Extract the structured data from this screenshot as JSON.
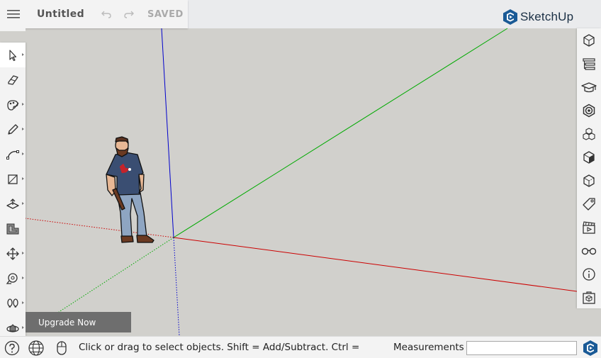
{
  "app": {
    "document_title": "Untitled",
    "save_status": "SAVED",
    "brand_name": "SketchUp"
  },
  "left_toolbar": {
    "tools": [
      {
        "name": "select-tool",
        "icon": "cursor-arrow-icon",
        "active": true
      },
      {
        "name": "eraser-tool",
        "icon": "eraser-icon"
      },
      {
        "name": "paint-bucket-tool",
        "icon": "paint-icon"
      },
      {
        "name": "pencil-tool",
        "icon": "pencil-icon"
      },
      {
        "name": "arc-tool",
        "icon": "arc-icon"
      },
      {
        "name": "rectangle-tool",
        "icon": "rectangle-icon"
      },
      {
        "name": "push-pull-tool",
        "icon": "push-pull-icon"
      },
      {
        "name": "offset-tool",
        "icon": "offset-icon"
      },
      {
        "name": "move-tool",
        "icon": "move-icon"
      },
      {
        "name": "tape-measure-tool",
        "icon": "tape-measure-icon"
      },
      {
        "name": "walk-tool",
        "icon": "footprints-icon"
      },
      {
        "name": "orbit-tool",
        "icon": "orbit-icon"
      }
    ]
  },
  "right_toolbar": {
    "panels": [
      {
        "name": "entity-info-panel",
        "icon": "cube-info-icon"
      },
      {
        "name": "outliner-panel",
        "icon": "outliner-icon"
      },
      {
        "name": "instructor-panel",
        "icon": "graduation-cap-icon"
      },
      {
        "name": "materials-panel",
        "icon": "materials-icon"
      },
      {
        "name": "components-panel",
        "icon": "components-icon"
      },
      {
        "name": "styles-panel",
        "icon": "styles-cube-icon"
      },
      {
        "name": "views-panel",
        "icon": "views-icon"
      },
      {
        "name": "tags-panel",
        "icon": "tag-icon"
      },
      {
        "name": "scenes-panel",
        "icon": "clapperboard-icon"
      },
      {
        "name": "display-panel",
        "icon": "glasses-icon"
      },
      {
        "name": "info-panel",
        "icon": "info-icon"
      },
      {
        "name": "3d-warehouse-panel",
        "icon": "warehouse-box-icon"
      }
    ]
  },
  "upgrade": {
    "label": "Upgrade Now"
  },
  "status_bar": {
    "message": "Click or drag to select objects. Shift = Add/Subtract. Ctrl =",
    "measurements_label": "Measurements",
    "measurements_value": "",
    "icons": [
      "help-icon",
      "globe-icon",
      "mouse-icon"
    ]
  },
  "colors": {
    "x_axis": "#cc0000",
    "y_axis": "#00aa00",
    "z_axis": "#0000cc",
    "ground": "#d1d0cc",
    "sky": "#eaebed",
    "toolbar": "#f3f3f3",
    "brand": "#1a5a96"
  }
}
